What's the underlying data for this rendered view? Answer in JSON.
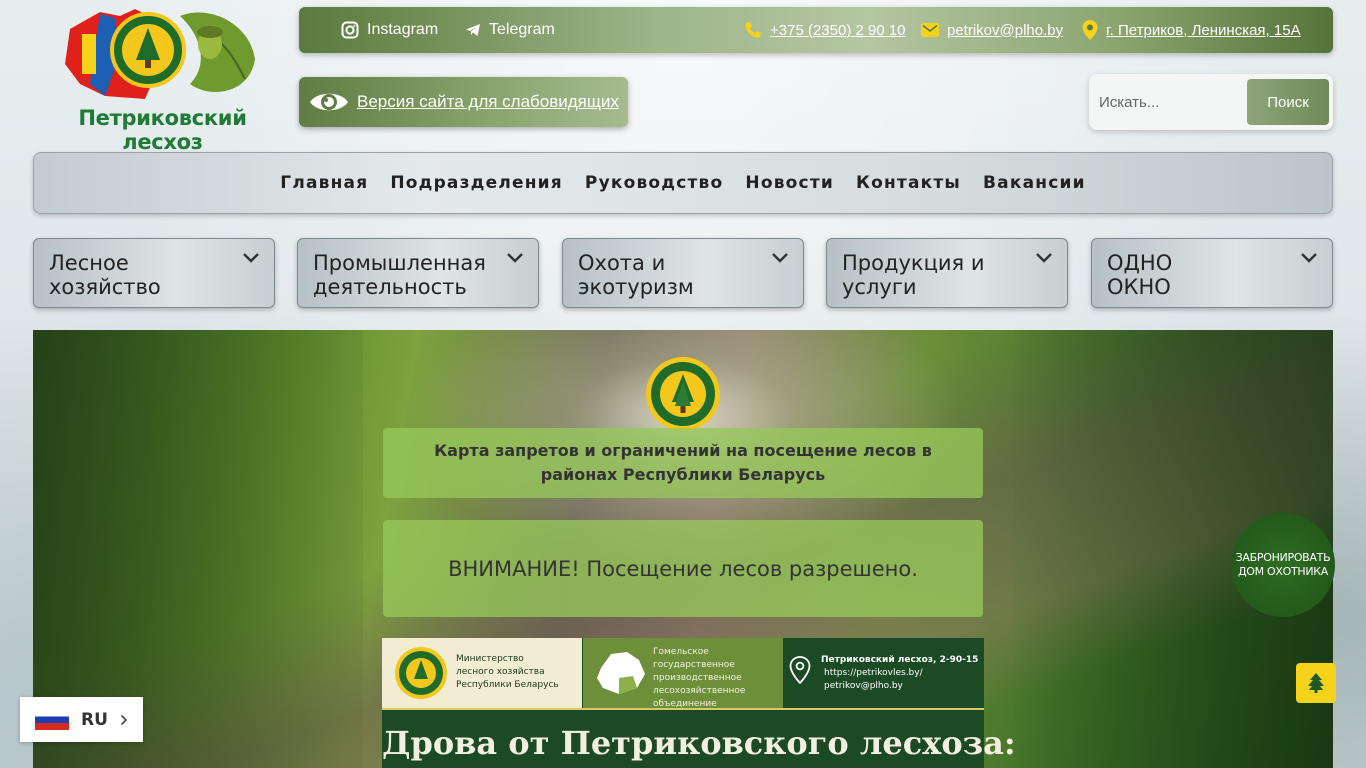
{
  "site": {
    "name": "Петриковский лесхоз"
  },
  "topbar": {
    "instagram_label": "Instagram",
    "telegram_label": "Telegram",
    "phone": "+375 (2350) 2 90 10",
    "email": "petrikov@plho.by",
    "address": "г. Петриков, Ленинская, 15А"
  },
  "lowvision": {
    "label": "Версия сайта для слабовидящих"
  },
  "search": {
    "placeholder": "Искать...",
    "button_label": "Поиск"
  },
  "mainnav": {
    "items": [
      "Главная",
      "Подразделения",
      "Руководство",
      "Новости",
      "Контакты",
      "Вакансии"
    ]
  },
  "categories": [
    {
      "label": "Лесное хозяйство"
    },
    {
      "label": "Промышленная деятельность"
    },
    {
      "label": "Охота и экотуризм"
    },
    {
      "label": "Продукция и услуги"
    },
    {
      "label": "ОДНО ОКНО"
    }
  ],
  "hero": {
    "map_notice": "Карта запретов и ограничений на посещение лесов в районах Республики Беларусь",
    "attention": "ВНИМАНИЕ! Посещение лесов разрешено.",
    "banner": {
      "ministry": "Министерство\nлесного хозяйства\nРеспублики Беларусь",
      "association": "Гомельское государственное\nпроизводственное\nлесохозяйственное\nобъединение",
      "contact_title": "Петриковский лесхоз, 2-90-15",
      "contact_site": "https://petrikovles.by/",
      "contact_email": "petrikov@plho.by",
      "title": "Дрова от Петриковского лесхоза:"
    }
  },
  "booking": {
    "label": "ЗАБРОНИРОВАТЬ ДОМ ОХОТНИКА"
  },
  "language": {
    "code": "RU"
  },
  "colors": {
    "brand_green": "#1f7a35",
    "accent_yellow": "#f6d21a",
    "topbar_green": "#5b7a3d"
  }
}
